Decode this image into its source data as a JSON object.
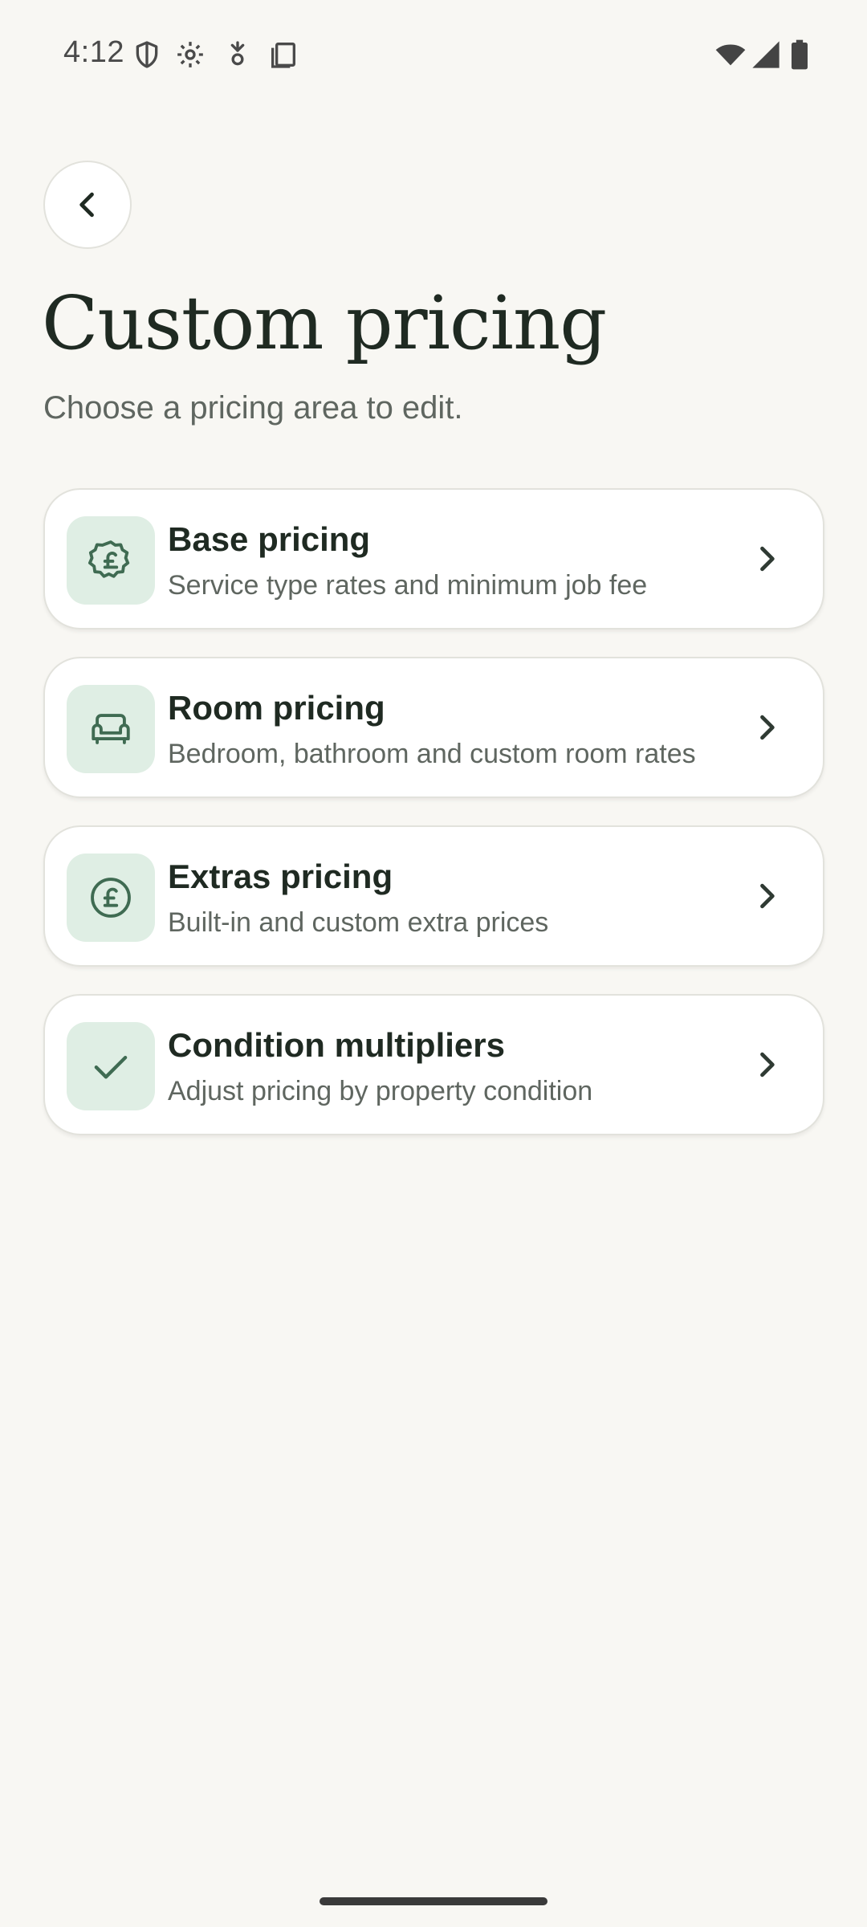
{
  "status_bar": {
    "time": "4:12",
    "left_icons": [
      "shield-icon",
      "settings-gear-icon",
      "download-arrow-icon",
      "copy-icon"
    ],
    "right_icons": [
      "wifi-icon",
      "signal-icon",
      "battery-icon"
    ]
  },
  "header": {
    "back_icon": "chevron-left-icon",
    "title": "Custom pricing",
    "subtitle": "Choose a pricing area to edit."
  },
  "cards": [
    {
      "icon": "pound-badge-icon",
      "title": "Base pricing",
      "description": "Service type rates and minimum job fee"
    },
    {
      "icon": "sofa-icon",
      "title": "Room pricing",
      "description": "Bedroom, bathroom and custom room rates"
    },
    {
      "icon": "pound-circle-icon",
      "title": "Extras pricing",
      "description": "Built-in and custom extra prices"
    },
    {
      "icon": "check-icon",
      "title": "Condition multipliers",
      "description": "Adjust pricing by property condition"
    }
  ],
  "colors": {
    "background": "#f8f7f3",
    "card": "#ffffff",
    "icon_tile": "#dfeee4",
    "icon_stroke": "#3f6b52",
    "title": "#1f2a22",
    "muted": "#5f6660"
  }
}
